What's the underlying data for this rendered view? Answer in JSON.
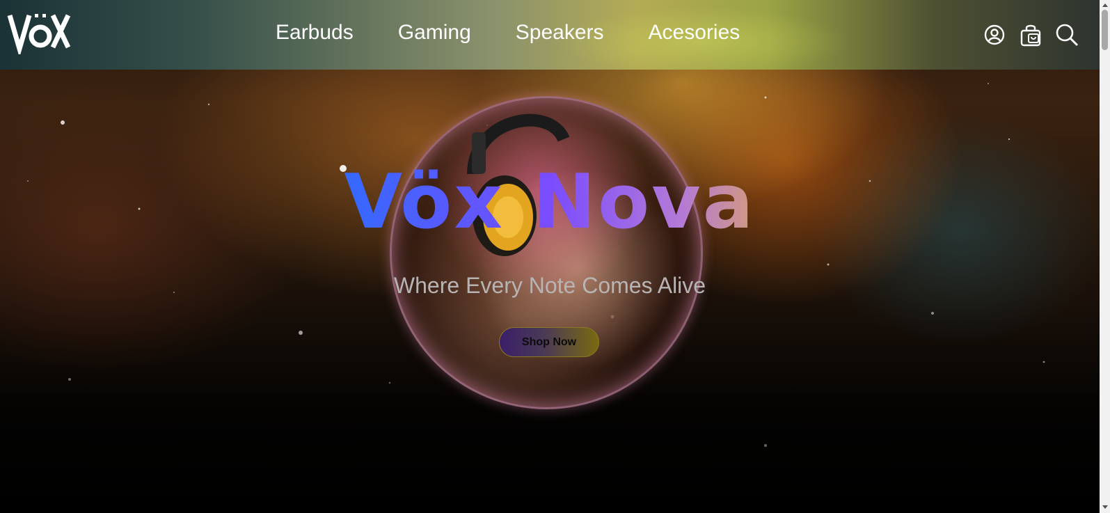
{
  "brand": {
    "logo_text": "VöX"
  },
  "nav": {
    "items": [
      "Earbuds",
      "Gaming",
      "Speakers",
      "Acesories"
    ]
  },
  "header_icons": [
    "account-icon",
    "shopping-bag-icon",
    "search-icon"
  ],
  "hero": {
    "title": "Vöx Nova",
    "subtitle": "Where Every Note Comes Alive",
    "cta_label": "Shop Now"
  },
  "colors": {
    "title_gradient": [
      "#2f6bff",
      "#7a4cff",
      "#b47ad6",
      "#d8a070"
    ],
    "cta_gradient": [
      "#3a1f6a",
      "#7a6a10"
    ],
    "nav_text": "#ffffff",
    "subtitle_text": "#b9b4b4"
  }
}
